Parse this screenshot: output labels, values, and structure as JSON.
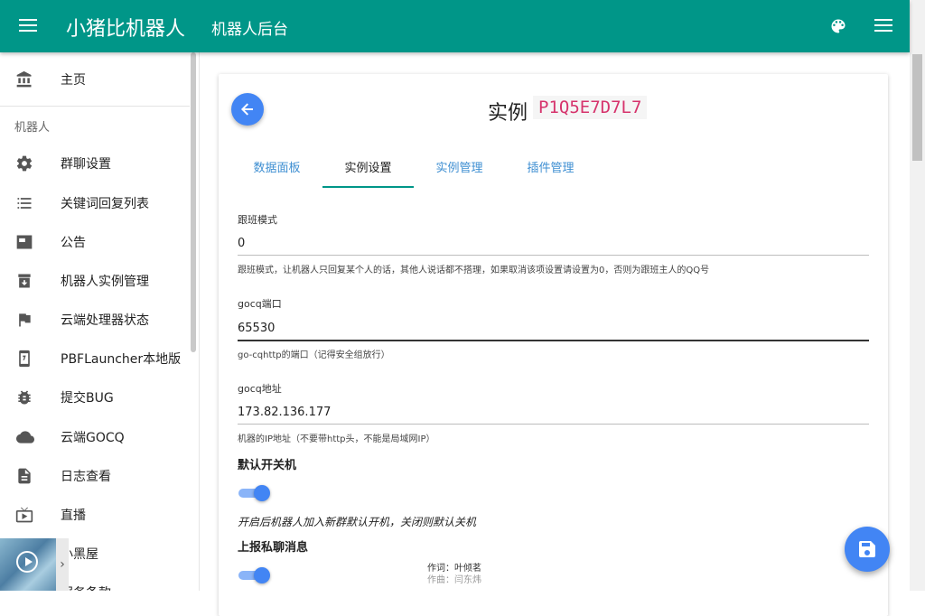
{
  "header": {
    "app_title": "小猪比机器人",
    "subtitle": "机器人后台",
    "menu_icon": "menu-icon",
    "palette_icon": "palette-icon",
    "more_icon": "menu-icon"
  },
  "sidebar": {
    "home": "主页",
    "section_label": "机器人",
    "items": [
      {
        "label": "群聊设置",
        "icon": "gear-icon"
      },
      {
        "label": "关键词回复列表",
        "icon": "list-icon"
      },
      {
        "label": "公告",
        "icon": "announcement-icon"
      },
      {
        "label": "机器人实例管理",
        "icon": "archive-icon"
      },
      {
        "label": "云端处理器状态",
        "icon": "flag-icon"
      },
      {
        "label": "PBFLauncher本地版",
        "icon": "phone-icon"
      },
      {
        "label": "提交BUG",
        "icon": "bug-icon"
      },
      {
        "label": "云端GOCQ",
        "icon": "cloud-icon"
      },
      {
        "label": "日志查看",
        "icon": "document-icon"
      },
      {
        "label": "直播",
        "icon": "tv-icon"
      },
      {
        "label": "小黑屋",
        "icon": "block-icon"
      },
      {
        "label": "服务条款",
        "icon": "document-icon"
      }
    ],
    "media_expand": "›"
  },
  "main": {
    "title": "实例",
    "instance_id": "P1Q5E7D7L7",
    "tabs": [
      "数据面板",
      "实例设置",
      "实例管理",
      "插件管理"
    ],
    "active_tab": "实例设置",
    "fields": {
      "follow_mode": {
        "label": "跟班模式",
        "value": "0",
        "hint": "跟班模式，让机器人只回复某个人的话，其他人说话都不搭理，如果取消该项设置请设置为0，否则为跟班主人的QQ号"
      },
      "gocq_port": {
        "label": "gocq端口",
        "value": "65530",
        "hint": "go-cqhttp的端口（记得安全组放行）"
      },
      "gocq_address": {
        "label": "gocq地址",
        "value": "173.82.136.177",
        "hint": "机器的IP地址（不要带http头，不能是局域网IP）"
      }
    },
    "switches": {
      "default_on": {
        "title": "默认开关机",
        "on": true,
        "desc": "开启后机器人加入新群默认开机，关闭则默认关机"
      },
      "report_private": {
        "title": "上报私聊消息",
        "on": true
      }
    },
    "lyrics": {
      "line1": "作词：叶倾茗",
      "line2": "作曲：闫东炜"
    }
  },
  "colors": {
    "appbar": "#009688",
    "accent": "#4285f4",
    "tab_active_underline": "#009688",
    "instance_code": "#d6336c"
  },
  "fab_icon": "save-icon",
  "back_icon": "arrow-left-icon"
}
